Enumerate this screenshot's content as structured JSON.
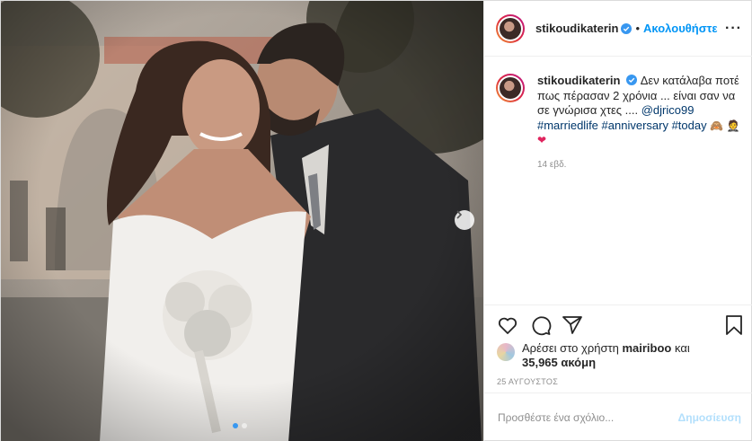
{
  "photo": {
    "alt_icon": "wedding-photo",
    "dots_count": 2,
    "active_dot": 0
  },
  "header": {
    "username": "stikoudikaterin",
    "separator": "•",
    "follow_label": "Ακολουθήστε",
    "more_label": "···"
  },
  "caption": {
    "username": "stikoudikaterin",
    "text_part1": "Δεν κατάλαβα ποτέ πως πέρασαν 2 χρόνια ... είναι σαν να σε γνώρισα χτες .... ",
    "mention": "@djrico99",
    "hashtags": "#marriedlife #anniversary #today",
    "emoji1": "🙈",
    "emoji2": "🤵",
    "emoji3": "❤",
    "time": "14 εβδ."
  },
  "likes": {
    "prefix": "Αρέσει στο χρήστη ",
    "user": "mairiboo",
    "middle": " και",
    "count": "35,965 ακόμη"
  },
  "date": "25 ΑΥΓΟΥΣΤΟΣ",
  "comment": {
    "placeholder": "Προσθέστε ένα σχόλιο...",
    "post_label": "Δημοσίευση"
  },
  "colors": {
    "link": "#0095f6",
    "post_disabled": "#b2dffc",
    "secondary": "#8e8e8e"
  }
}
